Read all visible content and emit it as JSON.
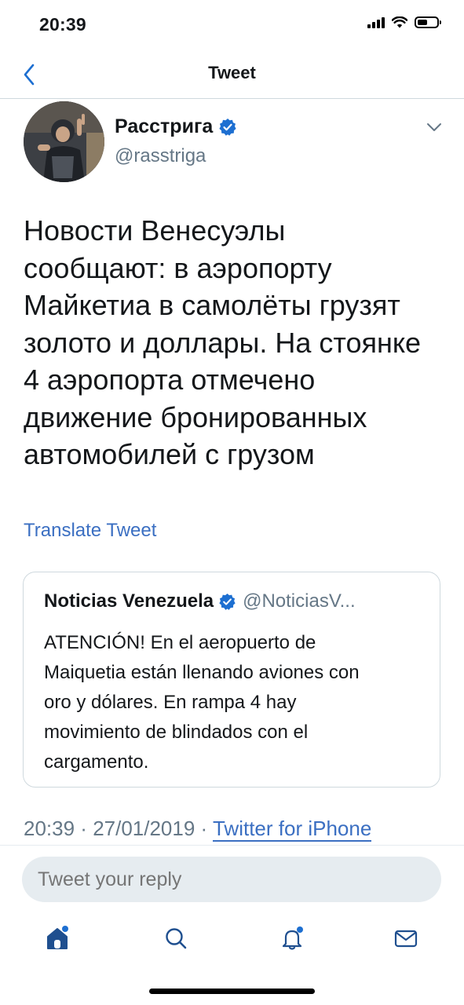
{
  "status_bar": {
    "time": "20:39"
  },
  "header": {
    "back_icon": "chevron-left-icon",
    "title": "Tweet"
  },
  "tweet": {
    "author": {
      "display_name": "Расстрига",
      "username": "@rasstriga",
      "verified": true
    },
    "text": "Новости Венесуэлы\nсообщают: в аэропорту\nМайкетиа в самолёты грузят\nзолото и доллары. На стоянке\n4 аэропорта отмечено\nдвижение бронированных\nавтомобилей с грузом",
    "translate_label": "Translate Tweet",
    "quoted": {
      "display_name": "Noticias Venezuela",
      "username": "@NoticiasV...",
      "verified": true,
      "text": "ATENCIÓN! En el aeropuerto de\nMaiquetia están llenando aviones con\noro y dólares. En rampa 4 hay\nmovimiento de blindados con el\ncargamento."
    },
    "meta": {
      "time": "20:39",
      "date": "27/01/2019",
      "separator": " · ",
      "source": "Twitter for iPhone"
    }
  },
  "reply": {
    "placeholder": "Tweet your reply"
  },
  "tab_bar": {
    "tabs": [
      "home-icon",
      "search-icon",
      "notifications-icon",
      "messages-icon"
    ],
    "active": "home-icon"
  },
  "colors": {
    "accent": "#1d6fd1",
    "link": "#3b6fc2",
    "verified": "#1d9bf0",
    "secondary_text": "#657786",
    "tab_icon": "#1f4f8f",
    "reply_bg": "#e6ecf0"
  }
}
